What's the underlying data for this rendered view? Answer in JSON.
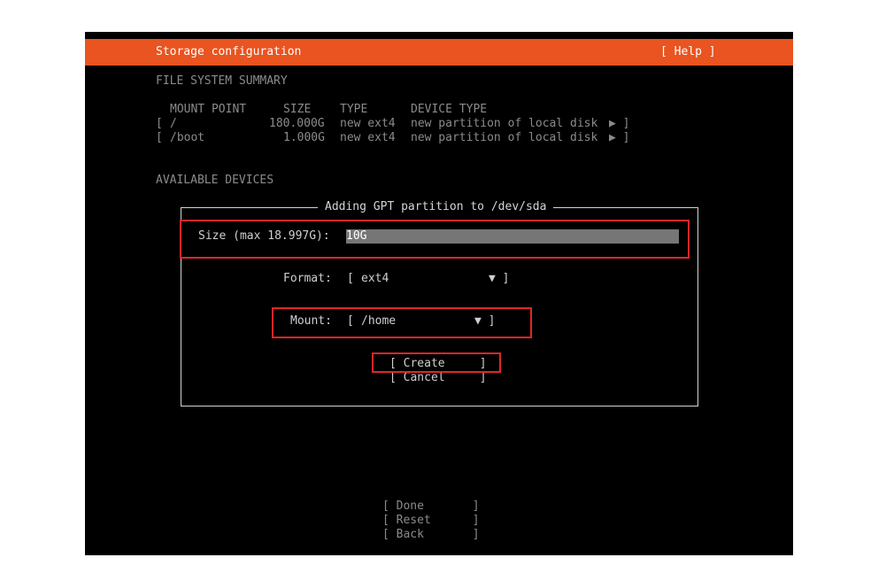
{
  "header": {
    "title": "Storage configuration",
    "help_label": "[ Help ]"
  },
  "summary": {
    "heading": "FILE SYSTEM SUMMARY",
    "columns": {
      "mount": "MOUNT POINT",
      "size": "SIZE",
      "type": "TYPE",
      "device_type": "DEVICE TYPE"
    },
    "rows": [
      {
        "open": "[",
        "mount": "/",
        "size": "180.000G",
        "type": "new ext4",
        "device_type": "new partition of local disk",
        "arrow": "▶ ]"
      },
      {
        "open": "[",
        "mount": "/boot",
        "size": "1.000G",
        "type": "new ext4",
        "device_type": "new partition of local disk",
        "arrow": "▶ ]"
      }
    ]
  },
  "available": {
    "heading": "AVAILABLE DEVICES"
  },
  "dialog": {
    "title": "Adding GPT partition to /dev/sda",
    "size_label": "Size (max 18.997G):",
    "size_value": "10G",
    "format_label": "Format:",
    "format_open": "[",
    "format_value": "ext4",
    "format_arrow": "▼ ]",
    "mount_label": "Mount:",
    "mount_open": "[",
    "mount_value": "/home",
    "mount_arrow": "▼ ]",
    "create_label": "[ Create     ]",
    "cancel_label": "[ Cancel     ]"
  },
  "footer": {
    "done_label": "[ Done       ]",
    "reset_label": "[ Reset      ]",
    "back_label": "[ Back       ]"
  },
  "colors": {
    "accent": "#e95420",
    "highlight": "#e0262a",
    "field": "#767676"
  }
}
